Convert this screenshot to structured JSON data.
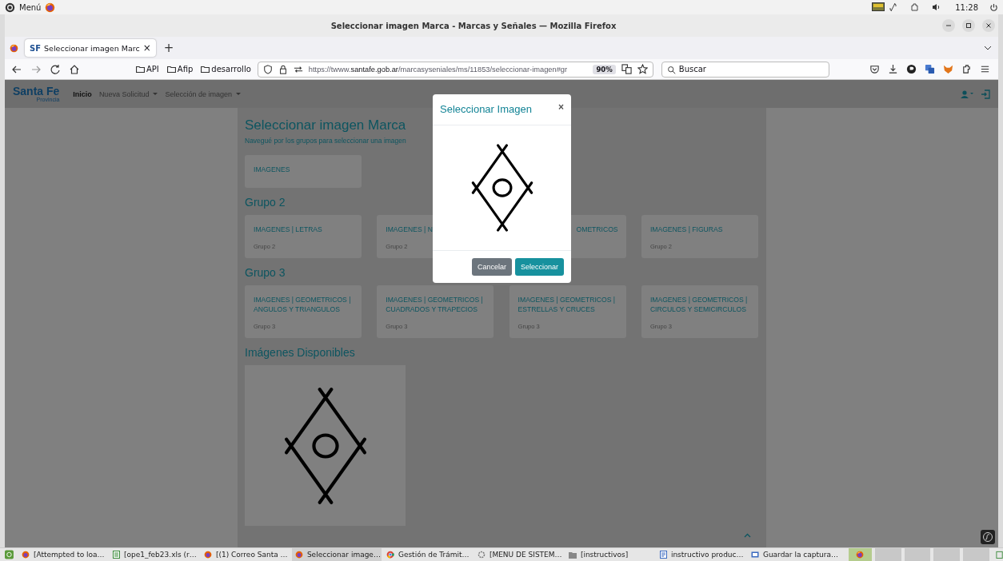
{
  "desktop_panel": {
    "menu_label": "Menú",
    "clock": "11:28"
  },
  "window": {
    "title": "Seleccionar imagen Marca - Marcas y Señales — Mozilla Firefox"
  },
  "tabs": [
    {
      "icon_text": "SF",
      "label": "Seleccionar imagen Marc",
      "close": "×",
      "selected": true
    }
  ],
  "new_tab": "+",
  "toolbar": {
    "bookmarks": [
      "API",
      "Afip",
      "desarrollo"
    ],
    "url": "https://twww.**santafe.gob.ar**/marcasyseniales/ms/11853/seleccionar-imagen#gr",
    "zoom": "90%",
    "search": {
      "placeholder": "Buscar"
    }
  },
  "site": {
    "logo": "Santa Fe",
    "logo_sub": "Provincia",
    "nav": [
      {
        "label": "Inicio",
        "selected": true,
        "dropdown": false
      },
      {
        "label": "Nueva Solicitud",
        "selected": false,
        "dropdown": true
      },
      {
        "label": "Selección de imagen",
        "selected": false,
        "dropdown": true
      }
    ],
    "heading": "Seleccionar imagen Marca",
    "subtitle": "Navegué por los grupos para seleccionar una imagen",
    "sections": [
      {
        "cards": [
          {
            "title": "IMAGENES"
          }
        ]
      },
      {
        "heading": "Grupo 2",
        "cards": [
          {
            "title": "IMAGENES | LETRAS",
            "group": "Grupo 2"
          },
          {
            "title": "IMAGENES | N",
            "group": "Grupo 2"
          },
          {
            "title": "OMETRICOS",
            "cut_left": true
          },
          {
            "title": "IMAGENES | FIGURAS",
            "group": "Grupo 2"
          }
        ]
      },
      {
        "heading": "Grupo 3",
        "cards": [
          {
            "title": "IMAGENES | GEOMETRICOS | ANGULOS Y TRIANGULOS",
            "group": "Grupo 3"
          },
          {
            "title": "IMAGENES | GEOMETRICOS | CUADRADOS Y TRAPECIOS",
            "group": "Grupo 3"
          },
          {
            "title": "IMAGENES | GEOMETRICOS | ESTRELLAS Y CRUCES",
            "group": "Grupo 3"
          },
          {
            "title": "IMAGENES | GEOMETRICOS | CIRCULOS Y SEMICIRCULOS",
            "group": "Grupo 3"
          }
        ]
      }
    ],
    "available_heading": "Imágenes Disponibles",
    "modal": {
      "title": "Seleccionar Imagen",
      "close": "×",
      "buttons": [
        {
          "label": "Cancelar",
          "kind": "secondary"
        },
        {
          "label": "Seleccionar",
          "kind": "primary"
        }
      ]
    }
  },
  "taskbar": {
    "items": [
      {
        "label": "[Attempted to loa…",
        "kind": "browser",
        "selected": false
      },
      {
        "label": "[ope1_feb23.xls (r…",
        "kind": "spreadsheet",
        "selected": false
      },
      {
        "label": "[(1) Correo Santa …",
        "kind": "browser",
        "selected": false
      },
      {
        "label": "Seleccionar image…",
        "kind": "browser",
        "selected": true
      },
      {
        "label": "Gestión de Trámit…",
        "kind": "chrome",
        "selected": false
      },
      {
        "label": "[MENU DE SISTEM…",
        "kind": "settings",
        "selected": false
      },
      {
        "label": "[instructivos]",
        "kind": "folder",
        "selected": false
      },
      {
        "label": "instructivo produc…",
        "kind": "document",
        "selected": false
      },
      {
        "label": "Guardar la captura…",
        "kind": "screenshot",
        "selected": false
      }
    ]
  }
}
